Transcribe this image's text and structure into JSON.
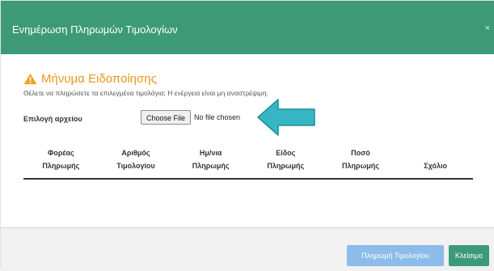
{
  "modal": {
    "title": "Ενημέρωση Πληρωμών Τιμολογίων",
    "close_icon": "×"
  },
  "notification": {
    "title": "Μήνυμα Ειδοποίησης",
    "text": "Θέλετε να πληρώσετε τα επιλεγμένα τιμολόγια; Η ενέργεια είναι μη αναστρέψιμη.",
    "icon": "warning-icon",
    "color": "#e8961c"
  },
  "file": {
    "label": "Επιλογή αρχείου",
    "button": "Choose File",
    "status": "No file chosen"
  },
  "annotation": {
    "icon": "arrow-left-icon",
    "color": "#36b6c3"
  },
  "table": {
    "columns": [
      {
        "line1": "Φορέας",
        "line2": "Πληρωμής"
      },
      {
        "line1": "Αριθμός",
        "line2": "Τιμολογίου"
      },
      {
        "line1": "Ημ/νια",
        "line2": "Πληρωμής"
      },
      {
        "line1": "Είδος",
        "line2": "Πληρωμής"
      },
      {
        "line1": "Ποσό",
        "line2": "Πληρωμής"
      },
      {
        "line1": "",
        "line2": "Σχόλιο"
      }
    ],
    "rows": []
  },
  "footer": {
    "pay_button": "Πληρωμή Τιμολογίου",
    "close_button": "Κλείσιμο"
  },
  "colors": {
    "header": "#3c9a79",
    "pay_button": "#8cbcea",
    "close_button": "#3c9a79"
  }
}
